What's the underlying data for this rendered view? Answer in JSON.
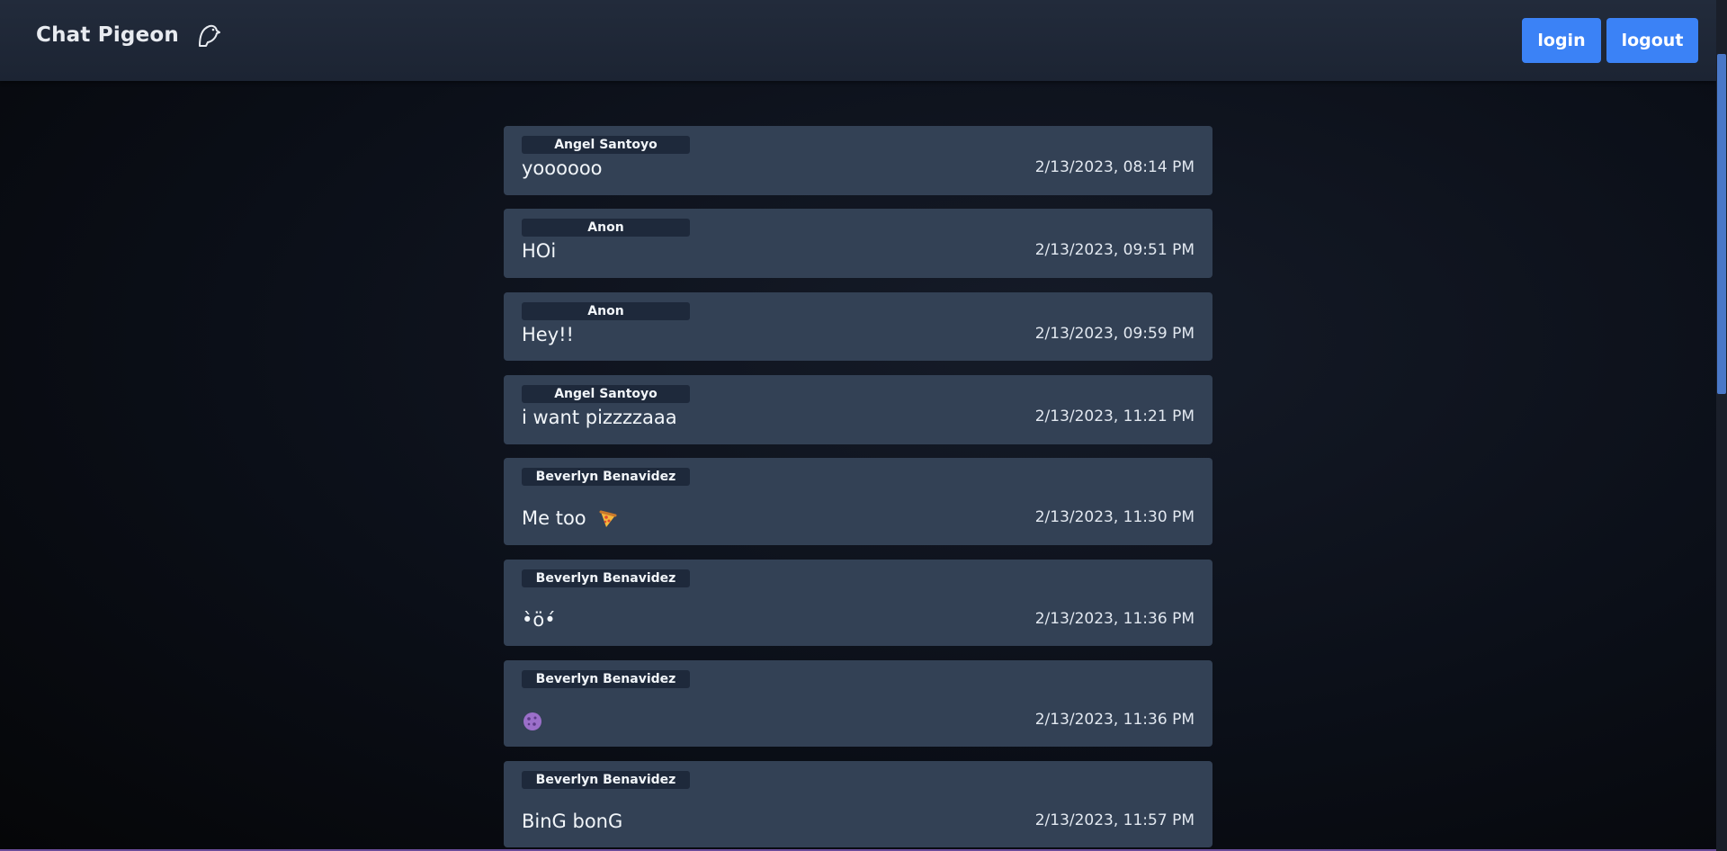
{
  "header": {
    "title": "Chat Pigeon",
    "logo_icon": "pigeon-icon",
    "login_label": "login",
    "logout_label": "logout"
  },
  "messages": [
    {
      "author": "Angel Santoyo",
      "text": "yoooooo",
      "time": "2/13/2023, 08:14 PM"
    },
    {
      "author": "Anon",
      "text": "HOi",
      "time": "2/13/2023, 09:51 PM"
    },
    {
      "author": "Anon",
      "text": "Hey!!",
      "time": "2/13/2023, 09:59 PM"
    },
    {
      "author": "Angel Santoyo",
      "text": "i want pizzzzaaa",
      "time": "2/13/2023, 11:21 PM"
    },
    {
      "author": "Beverlyn Benavidez",
      "text": "Me too",
      "emoji": "pizza-icon",
      "time": "2/13/2023, 11:30 PM"
    },
    {
      "author": "Beverlyn Benavidez",
      "text": "•̀ö•́",
      "time": "2/13/2023, 11:36 PM"
    },
    {
      "author": "Beverlyn Benavidez",
      "text": "",
      "emoji": "cookie-icon",
      "time": "2/13/2023, 11:36 PM"
    },
    {
      "author": "Beverlyn Benavidez",
      "text": "BinG bonG",
      "time": "2/13/2023, 11:57 PM"
    }
  ],
  "colors": {
    "accent": "#3b82f6",
    "card": "#334155",
    "author_badge": "#1e293b",
    "header": "#1f2736"
  }
}
